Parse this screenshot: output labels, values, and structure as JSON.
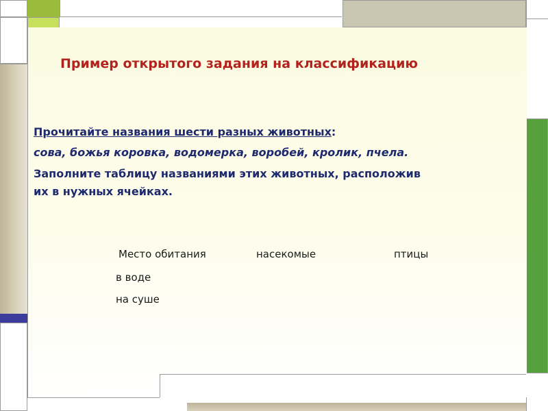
{
  "slide": {
    "title": "Пример открытого задания на классификацию",
    "instruction_part1": "Прочитайте названия шести разных животных",
    "instruction_colon": ":",
    "animals_list": "сова, божья коровка, водомерка, воробей, кролик, пчела.",
    "task_line1": "Заполните таблицу названиями этих животных, расположив",
    "task_line2": "их в нужных ячейках."
  },
  "table": {
    "headers": [
      "Место обитания",
      "насекомые",
      "птицы"
    ],
    "rows": [
      {
        "label": "в воде"
      },
      {
        "label": "на суше"
      }
    ]
  },
  "colors": {
    "title": "#b2231d",
    "text": "#1f2a6e",
    "accent_green": "#56a13d",
    "accent_lime": "#c6e05b",
    "accent_navy": "#3c3c9c"
  }
}
